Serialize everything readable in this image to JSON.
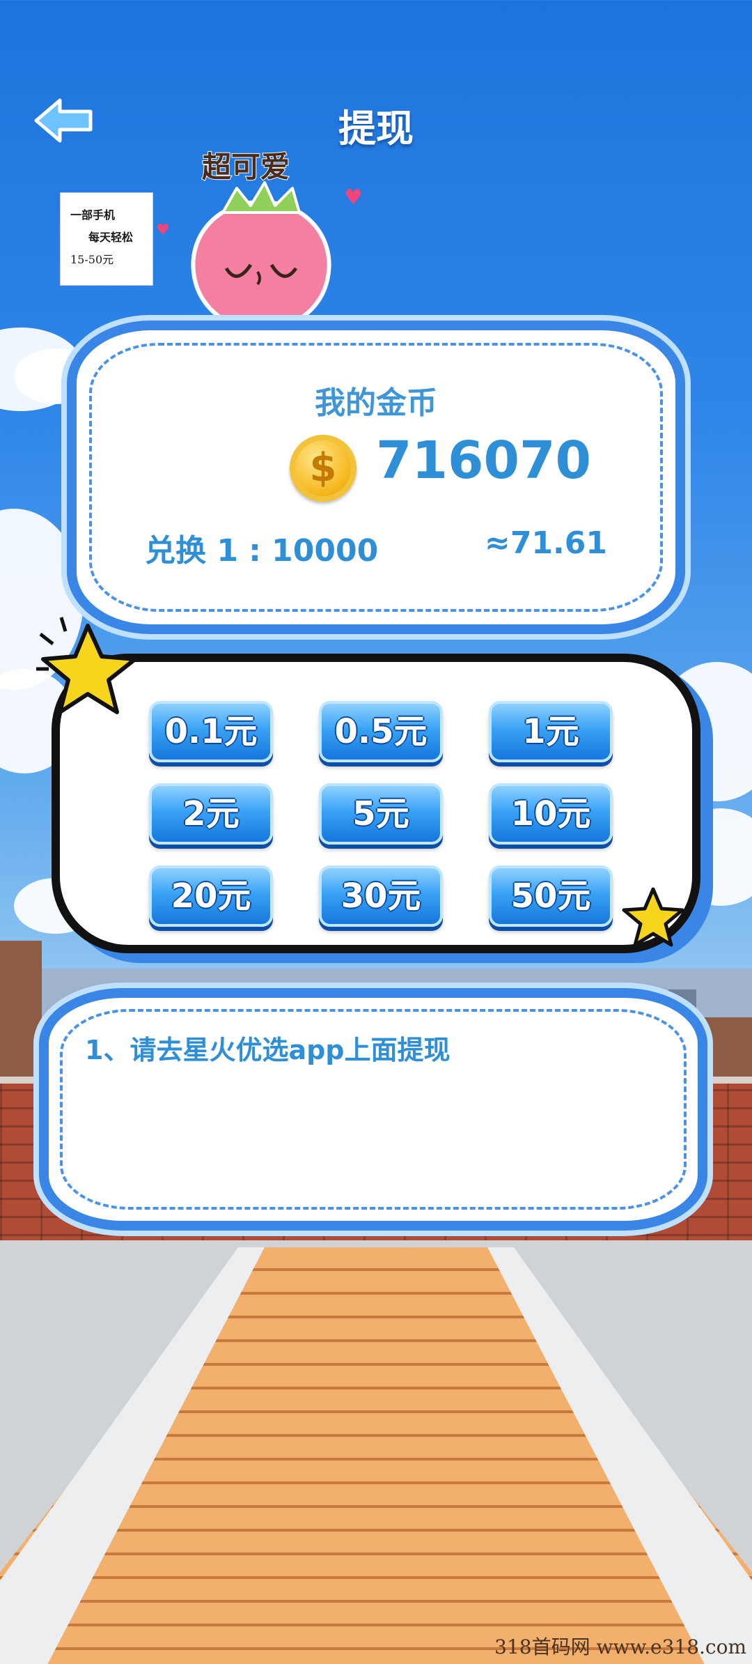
{
  "header": {
    "title": "提现",
    "back_icon": "arrow-left-icon"
  },
  "promo_sticker": {
    "line1": "一部手机",
    "line2": "每天轻松",
    "line3": "15-50元"
  },
  "mascot": {
    "caption": "超可爱",
    "icon": "strawberry-mascot-icon"
  },
  "coins": {
    "label": "我的金币",
    "amount": "716070",
    "exchange_rate": "兑换 1 : 10000",
    "exchange_value": "≈71.61",
    "coin_color": "#f5b81c"
  },
  "amounts": [
    {
      "label": "0.1元"
    },
    {
      "label": "0.5元"
    },
    {
      "label": "1元"
    },
    {
      "label": "2元"
    },
    {
      "label": "5元"
    },
    {
      "label": "10元"
    },
    {
      "label": "20元"
    },
    {
      "label": "30元"
    },
    {
      "label": "50元"
    }
  ],
  "notice": {
    "text": "1、请去星火优选app上面提现"
  },
  "watermark": "318首码网 www.e318.com",
  "colors": {
    "accent": "#3a86e6",
    "text_blue": "#2f8fd6",
    "button_blue": "#1577dc",
    "star_yellow": "#f7d51d"
  }
}
